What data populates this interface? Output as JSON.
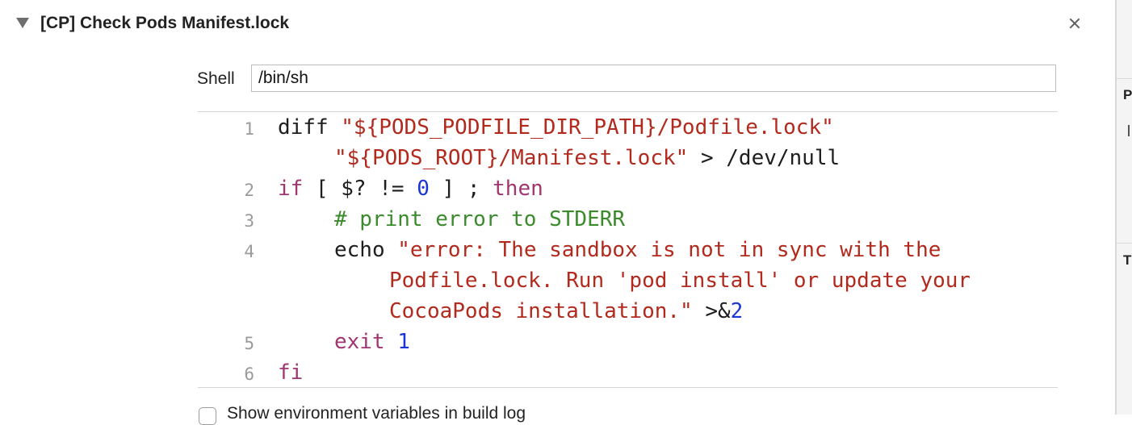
{
  "phase": {
    "title": "[CP] Check Pods Manifest.lock",
    "disclosure_icon": "triangle-down-icon",
    "close_icon": "close-icon"
  },
  "shell": {
    "label": "Shell",
    "value": "/bin/sh"
  },
  "script": {
    "line_numbers": [
      "1",
      "2",
      "3",
      "4",
      "5",
      "6"
    ],
    "tokens": {
      "l1_a": "diff ",
      "l1_b": "\"${PODS_PODFILE_DIR_PATH}/Podfile.lock\"",
      "l1c_a": "\"${PODS_ROOT}/Manifest.lock\"",
      "l1c_b": " > /dev/null",
      "l2_if": "if",
      "l2_a": " [ $? != ",
      "l2_zero": "0",
      "l2_b": " ] ; ",
      "l2_then": "then",
      "l3_comment": "# print error to STDERR",
      "l4_echo": "echo ",
      "l4_str1": "\"error: The sandbox is not in sync with the",
      "l4_str2": "Podfile.lock. Run 'pod install' or update your",
      "l4_str3": "CocoaPods installation.\"",
      "l4_redir": " >&",
      "l4_two": "2",
      "l5_exit": "exit",
      "l5_sp": " ",
      "l5_one": "1",
      "l6_fi": "fi"
    }
  },
  "options": {
    "show_env_label": "Show environment variables in build log",
    "show_env_checked": false
  },
  "right_panel": {
    "letter_1": "P",
    "letter_2": "T"
  },
  "colors": {
    "string": "#b22a1d",
    "keyword": "#a1356f",
    "number": "#1b36d6",
    "comment": "#3b8a2b"
  }
}
